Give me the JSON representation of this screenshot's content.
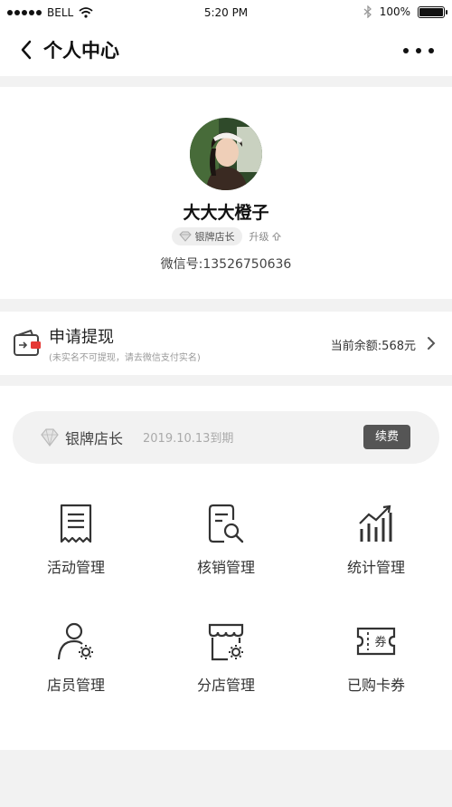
{
  "status_bar": {
    "carrier": "BELL",
    "time": "5:20 PM",
    "battery": "100%"
  },
  "nav": {
    "title": "个人中心"
  },
  "profile": {
    "name": "大大大橙子",
    "level": "银牌店长",
    "upgrade": "升级",
    "wechat_id": "微信号:13526750636"
  },
  "withdraw": {
    "title": "申请提现",
    "hint": "(未实名不可提现，请去微信支付实名)",
    "balance": "当前余额:568元"
  },
  "membership": {
    "level": "银牌店长",
    "expire": "2019.10.13到期",
    "renew": "续费"
  },
  "menu": [
    {
      "label": "活动管理",
      "icon": "receipt-icon"
    },
    {
      "label": "核销管理",
      "icon": "document-search-icon"
    },
    {
      "label": "统计管理",
      "icon": "bar-chart-icon"
    },
    {
      "label": "店员管理",
      "icon": "user-settings-icon"
    },
    {
      "label": "分店管理",
      "icon": "store-settings-icon"
    },
    {
      "label": "已购卡券",
      "icon": "ticket-icon"
    }
  ]
}
